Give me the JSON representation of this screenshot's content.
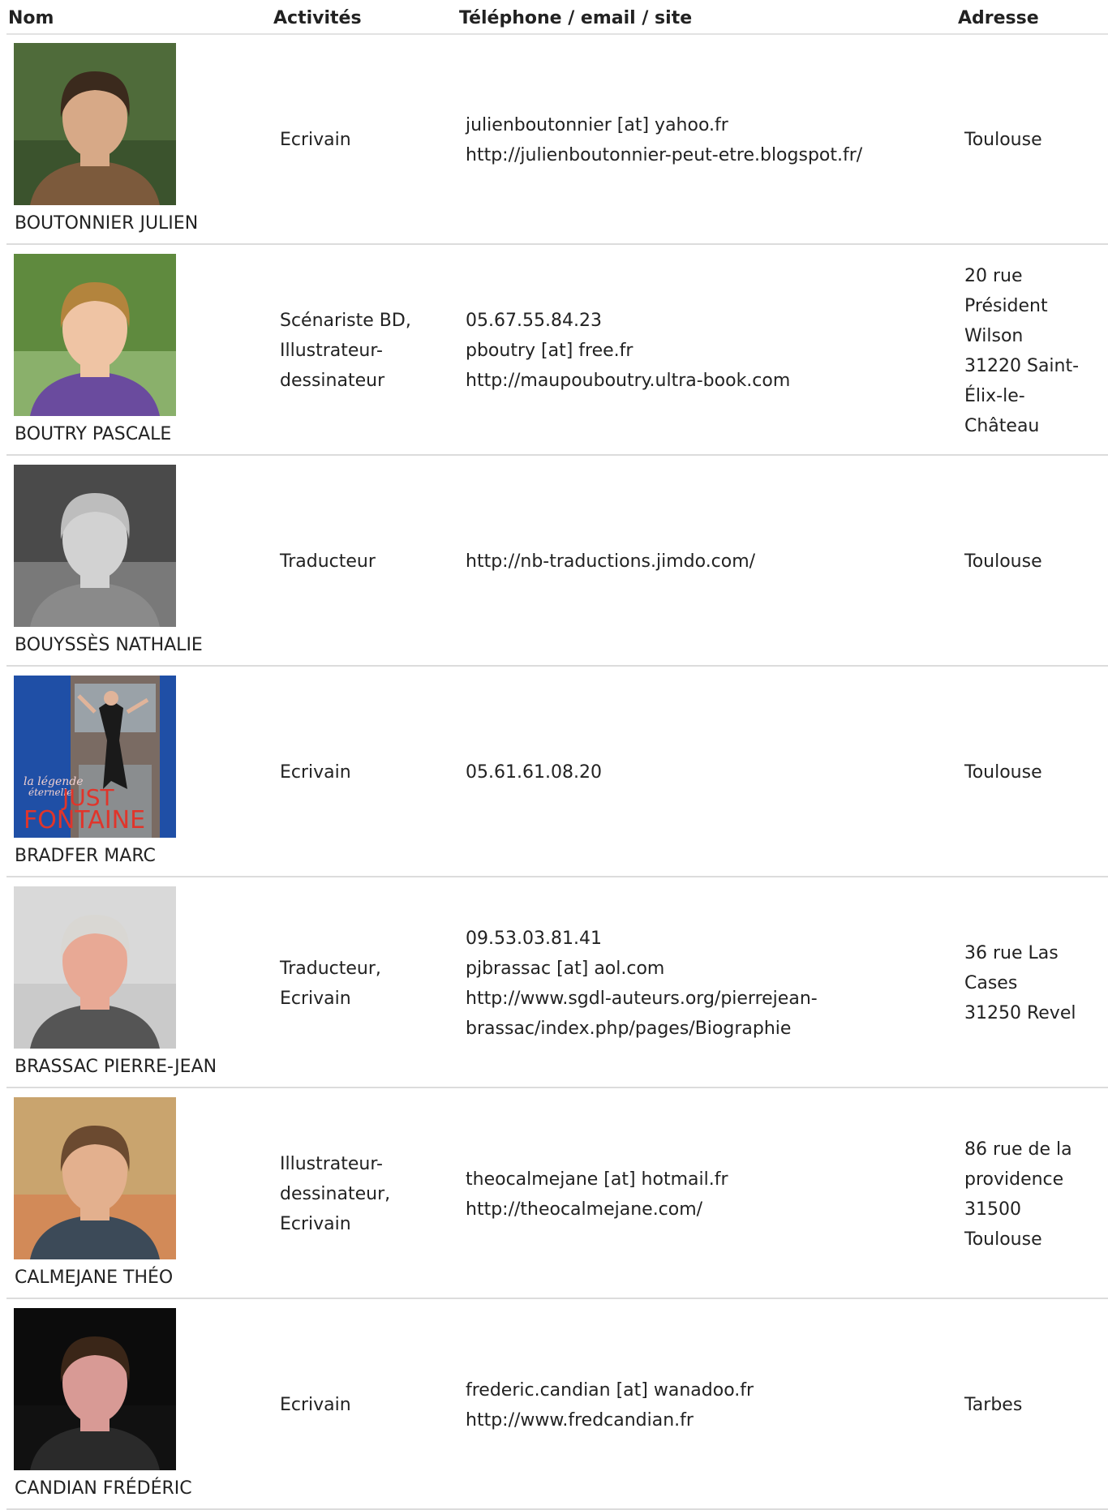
{
  "headers": {
    "nom": "Nom",
    "activites": "Activités",
    "contact": "Téléphone / email / site",
    "adresse": "Adresse"
  },
  "rows": [
    {
      "name": "BOUTONNIER JULIEN",
      "photo": "portrait-man-curly-hair",
      "activities": [
        "Ecrivain"
      ],
      "contact": [
        "julienboutonnier [at] yahoo.fr",
        "http://julienboutonnier-peut-etre.blogspot.fr/"
      ],
      "address": [
        "Toulouse"
      ]
    },
    {
      "name": "BOUTRY PASCALE",
      "photo": "portrait-woman-curly-hair-purple-top",
      "activities": [
        "Scénariste BD,",
        "Illustrateur-",
        "dessinateur"
      ],
      "contact": [
        "05.67.55.84.23",
        "pboutry [at] free.fr",
        "http://maupouboutry.ultra-book.com"
      ],
      "address": [
        "20 rue",
        "Président",
        "Wilson",
        "31220 Saint-",
        "Élix-le-",
        "Château"
      ]
    },
    {
      "name": "BOUYSSÈS NATHALIE",
      "photo": "portrait-woman-black-and-white",
      "activities": [
        "Traducteur"
      ],
      "contact": [
        "http://nb-traductions.jimdo.com/"
      ],
      "address": [
        "Toulouse"
      ]
    },
    {
      "name": "BRADFER MARC",
      "photo": "book-cover-just-fontaine",
      "cover_text": [
        "la légende",
        "éternelle",
        "JUST",
        "FONTAINE"
      ],
      "activities": [
        "Ecrivain"
      ],
      "contact": [
        "05.61.61.08.20"
      ],
      "address": [
        "Toulouse"
      ]
    },
    {
      "name": "BRASSAC PIERRE-JEAN",
      "photo": "portrait-man-glasses-smiling",
      "activities": [
        "Traducteur,",
        "Ecrivain"
      ],
      "contact": [
        "09.53.03.81.41",
        "pjbrassac [at] aol.com",
        "http://www.sgdl-auteurs.org/pierrejean-",
        "brassac/index.php/pages/Biographie"
      ],
      "address": [
        "36 rue Las",
        "Cases",
        "31250 Revel"
      ]
    },
    {
      "name": "CALMEJANE THÉO",
      "photo": "portrait-man-beard-smiling",
      "activities": [
        "Illustrateur-",
        "dessinateur,",
        "Ecrivain"
      ],
      "contact": [
        "theocalmejane [at] hotmail.fr",
        "http://theocalmejane.com/"
      ],
      "address": [
        "86 rue de la",
        "providence",
        "31500",
        "Toulouse"
      ]
    },
    {
      "name": "CANDIAN FRÉDÉRIC",
      "photo": "portrait-man-long-hair-dark-background",
      "activities": [
        "Ecrivain"
      ],
      "contact": [
        "frederic.candian [at] wanadoo.fr",
        "http://www.fredcandian.fr"
      ],
      "address": [
        "Tarbes"
      ]
    }
  ]
}
